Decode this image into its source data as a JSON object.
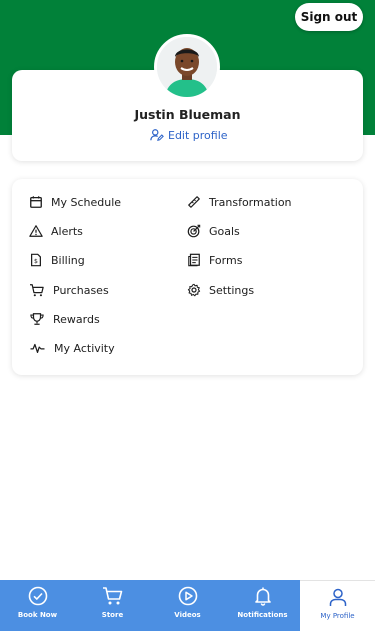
{
  "header": {
    "sign_out_label": "Sign out",
    "bg_color": "#018139"
  },
  "profile": {
    "name": "Justin Blueman",
    "edit_label": "Edit profile",
    "avatar_icon": "person-photo"
  },
  "menu": {
    "left": [
      {
        "label": "My Schedule",
        "icon": "calendar-icon"
      },
      {
        "label": "Alerts",
        "icon": "warning-icon"
      },
      {
        "label": "Billing",
        "icon": "invoice-icon"
      },
      {
        "label": "Purchases",
        "icon": "cart-icon"
      },
      {
        "label": "Rewards",
        "icon": "trophy-icon"
      },
      {
        "label": "My Activity",
        "icon": "activity-icon"
      }
    ],
    "right": [
      {
        "label": "Transformation",
        "icon": "ruler-icon"
      },
      {
        "label": "Goals",
        "icon": "target-icon"
      },
      {
        "label": "Forms",
        "icon": "forms-icon"
      },
      {
        "label": "Settings",
        "icon": "gear-icon"
      }
    ]
  },
  "nav": {
    "items": [
      {
        "label": "Book Now",
        "icon": "check-circle-icon"
      },
      {
        "label": "Store",
        "icon": "cart-icon"
      },
      {
        "label": "Videos",
        "icon": "play-circle-icon"
      },
      {
        "label": "Notifications",
        "icon": "bell-icon"
      },
      {
        "label": "My Profile",
        "icon": "user-icon"
      }
    ],
    "active_index": 4,
    "bg_color": "#4c8fe2",
    "active_color": "#2d63c8"
  }
}
